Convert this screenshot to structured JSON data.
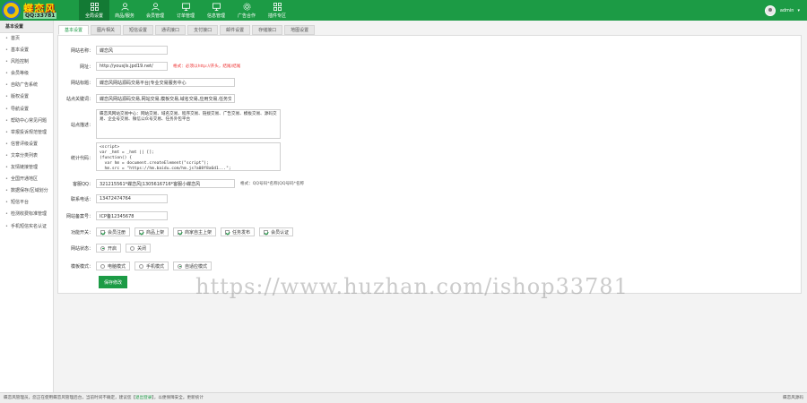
{
  "brand": {
    "name": "蝶恋风",
    "qq": "QQ:33781"
  },
  "nav": {
    "items": [
      {
        "label": "全局设置",
        "icon": "grid-icon"
      },
      {
        "label": "商品/服务",
        "icon": "user-icon"
      },
      {
        "label": "会员管理",
        "icon": "user-icon"
      },
      {
        "label": "订单管理",
        "icon": "monitor-icon"
      },
      {
        "label": "信息管理",
        "icon": "monitor-icon"
      },
      {
        "label": "广告合作",
        "icon": "gear-icon"
      },
      {
        "label": "插件专区",
        "icon": "grid-icon"
      }
    ]
  },
  "user": {
    "name": "admin"
  },
  "sidebar": {
    "title": "基本设置",
    "items": [
      "首页",
      "基本设置",
      "风险控制",
      "会员等级",
      "自助广告系统",
      "版权设置",
      "导航设置",
      "帮助中心常见问题",
      "举报投诉规范管理",
      "信誉评级设置",
      "文章分类列表",
      "友情链接管理",
      "全国开通地区",
      "数据保存/区域划分",
      "短信平台",
      "检测收费标准管理",
      "手机短信实名认证"
    ]
  },
  "tabs": [
    "基本设置",
    "图片相关",
    "短信设置",
    "通讯接口",
    "支付接口",
    "邮件设置",
    "存储接口",
    "地图设置"
  ],
  "form": {
    "site_name": {
      "label": "网站名称：",
      "value": "蝶恋风"
    },
    "site_url": {
      "label": "网址：",
      "value": "http://yousjls.jpd19.net/",
      "hint": "格式：必须以http://开头，结尾/结尾"
    },
    "site_title": {
      "label": "网站标题：",
      "value": "蝶恋风网站源码交易平台|专业交易服务中心"
    },
    "keywords": {
      "label": "站点关键词：",
      "value": "蝶恋风网站源码交易,网站交易,模板交易,域名交易,应用交易,任务交易"
    },
    "description": {
      "label": "站点描述：",
      "value": "蝶恋风网站交易中心：网站交易、域名交易、程序交易、链接交易、广告交易、模板交易、源码交易、企业号交易、微信公众号交易、任务外包平台"
    },
    "stats_code": {
      "label": "统计代码：",
      "value": "<script>\nvar _hmt = _hmt || [];\n(function() {\n  var hm = document.createElement(\"script\");\n  hm.src = \"https://hm.baidu.com/hm.js?a08f8a6d1...\";"
    },
    "service_qq": {
      "label": "客服QQ：",
      "value": "321215561*蝶恋风|1305616716*客服小蝶恋风",
      "hint": "格式：QQ号码*名称|QQ号码*名称"
    },
    "phone": {
      "label": "联系电话：",
      "value": "13472474764"
    },
    "icp": {
      "label": "网站备案号：",
      "value": "ICP备12345678"
    },
    "features": {
      "label": "功能开关：",
      "options": [
        {
          "label": "会员注册",
          "checked": true
        },
        {
          "label": "商品上架",
          "checked": true
        },
        {
          "label": "商家自主上架",
          "checked": true
        },
        {
          "label": "任务发布",
          "checked": true
        },
        {
          "label": "会员认证",
          "checked": true
        }
      ]
    },
    "site_status": {
      "label": "网站状态：",
      "options": [
        {
          "label": "开启",
          "checked": true
        },
        {
          "label": "关闭",
          "checked": false
        }
      ]
    },
    "template_mode": {
      "label": "模板模式：",
      "options": [
        {
          "label": "电脑模式",
          "checked": false
        },
        {
          "label": "手机模式",
          "checked": false
        },
        {
          "label": "自适应模式",
          "checked": true
        }
      ]
    },
    "save_label": "保存修改"
  },
  "footer": {
    "text_before": "蝶恋风管理员，您正在使用蝶恋风管理后台，当前时间不确定，建议您【",
    "link_text": "退出登录",
    "text_after": "】，以便保障安全。更新统计",
    "right_text": "蝶恋风源码"
  },
  "watermark": "https://www.huzhan.com/ishop33781",
  "colors": {
    "accent": "#1c9b45",
    "hint_red": "#e33333"
  }
}
